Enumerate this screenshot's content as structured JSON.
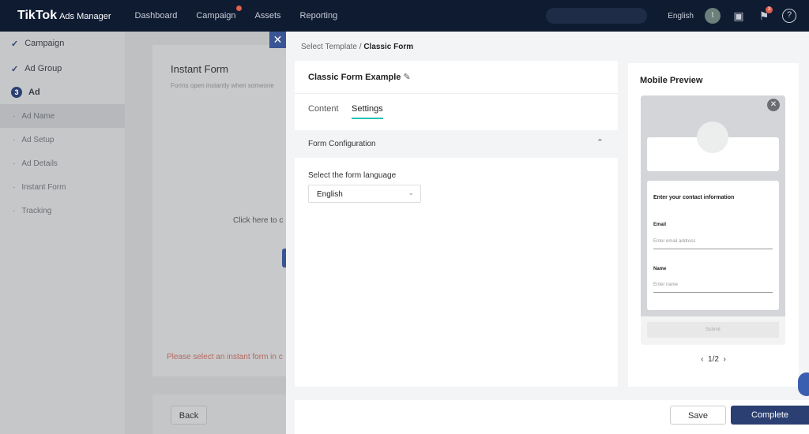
{
  "header": {
    "logo": "TikTok",
    "logo_sub": "Ads Manager",
    "nav": [
      "Dashboard",
      "Campaign",
      "Assets",
      "Reporting"
    ],
    "language": "English",
    "avatar": "t",
    "notif_count": "3"
  },
  "sidebar": {
    "items": [
      {
        "label": "Campaign"
      },
      {
        "label": "Ad Group"
      },
      {
        "label": "Ad",
        "step": "3"
      },
      {
        "label": "Ad Name"
      },
      {
        "label": "Ad Setup"
      },
      {
        "label": "Ad Details"
      },
      {
        "label": "Instant Form"
      },
      {
        "label": "Tracking"
      }
    ]
  },
  "left": {
    "title": "Instant Form",
    "desc": "Forms open instantly when someone",
    "click": "Click here to c",
    "error": "Please select an instant form in c",
    "back": "Back"
  },
  "drawer": {
    "breadcrumb_1": "Select Template",
    "breadcrumb_sep": "/",
    "breadcrumb_2": "Classic Form",
    "form_name": "Classic Form Example",
    "tabs": [
      "Content",
      "Settings"
    ],
    "section": "Form Configuration",
    "lang_label": "Select the form language",
    "lang_value": "English",
    "save": "Save",
    "complete": "Complete"
  },
  "preview": {
    "title": "Mobile Preview",
    "heading": "Enter your contact information",
    "email_label": "Email",
    "email_placeholder": "Enter email address",
    "name_label": "Name",
    "name_placeholder": "Enter name",
    "submit": "Submit",
    "page": "1/2"
  },
  "colors": {
    "accent": "#2b3f73",
    "tab_underline": "#25c3b5",
    "header": "#0e1b31"
  }
}
